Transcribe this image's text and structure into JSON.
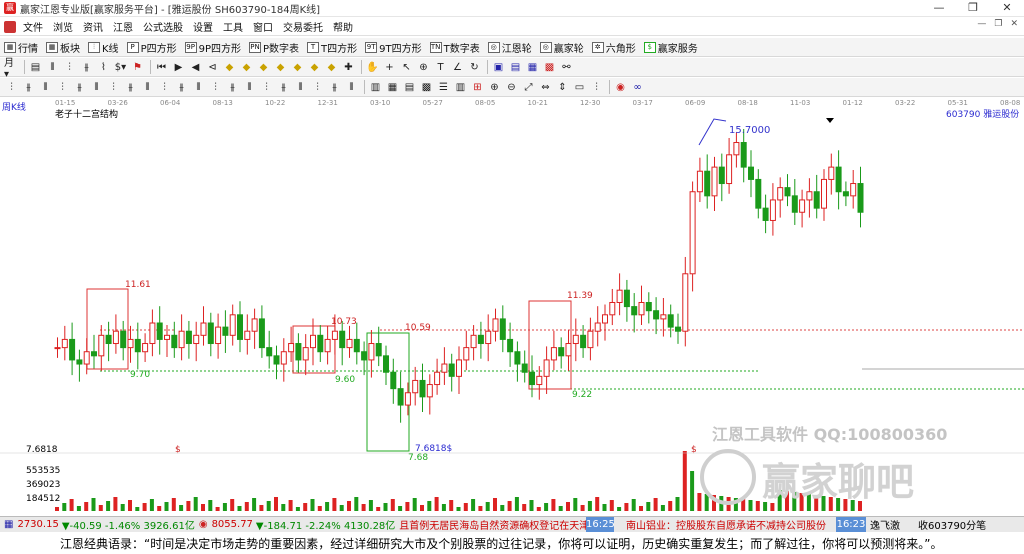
{
  "window": {
    "title": "赢家江恩专业版[赢家服务平台] - [雅运股份  SH603790-184周K线]"
  },
  "menu": [
    "文件",
    "浏览",
    "资讯",
    "江恩",
    "公式选股",
    "设置",
    "工具",
    "窗口",
    "交易委托",
    "帮助"
  ],
  "toolbar1": [
    "行情",
    "板块",
    "K线",
    "P四方形",
    "9P四方形",
    "P数字表",
    "T四方形",
    "9T四方形",
    "T数字表",
    "江恩轮",
    "赢家轮",
    "六角形",
    "赢家服务"
  ],
  "chart": {
    "period_label": "周K线",
    "indicator_label": "老子十二宫结构",
    "stock_label": "603790  雅运股份",
    "date_ticks": [
      "01-15",
      "03-26",
      "06-04",
      "08-13",
      "10-22",
      "12-31",
      "03-10",
      "05-27",
      "08-05",
      "10-21",
      "12-30",
      "03-17",
      "06-09",
      "08-18",
      "11-03",
      "01-12",
      "03-22",
      "05-31",
      "08-08"
    ],
    "annotations": {
      "high": "15.7000",
      "box1_top": "11.61",
      "box1_bottom": "9.70",
      "box2_top": "10.73",
      "box2_bottom": "9.60",
      "mid_red": "10.59",
      "box3_bottom": "7.6818$",
      "box3_low": "7.68",
      "box4_top": "11.39",
      "box4_bottom": "9.22",
      "dollar": "$"
    },
    "volume_axis": [
      "7.6818",
      "553535",
      "369023",
      "184512"
    ],
    "watermark1": "江恩工具软件  QQ:100800360",
    "watermark2": "赢家聊吧"
  },
  "status": {
    "sh_index": "2730.15",
    "sh_change": "▼-40.59 -1.46% 3926.61亿",
    "sz_index": "8055.77",
    "sz_change": "▼-184.71 -2.24% 4130.28亿",
    "news1": "且首例无居民海岛自然资源确权登记在天津完成",
    "time1": "16:25",
    "news2": "南山铝业：控股股东自愿承诺不减持公司股份",
    "time2": "16:23",
    "news3": "逸飞激",
    "receive": "收603790分笔"
  },
  "quote": "江恩经典语录：“时间是决定市场走势的重要因素，经过详细研究大市及个别股票的过往记录，你将可以证明，历史确实重复发生；而了解过往，你将可以预测将来。”。",
  "chart_data": {
    "type": "candlestick",
    "title": "老子十二宫结构",
    "price_levels": [
      15.7,
      11.61,
      11.39,
      10.73,
      10.59,
      9.7,
      9.6,
      9.22,
      7.68
    ],
    "volume_ticks": [
      553535,
      369023,
      184512
    ]
  }
}
